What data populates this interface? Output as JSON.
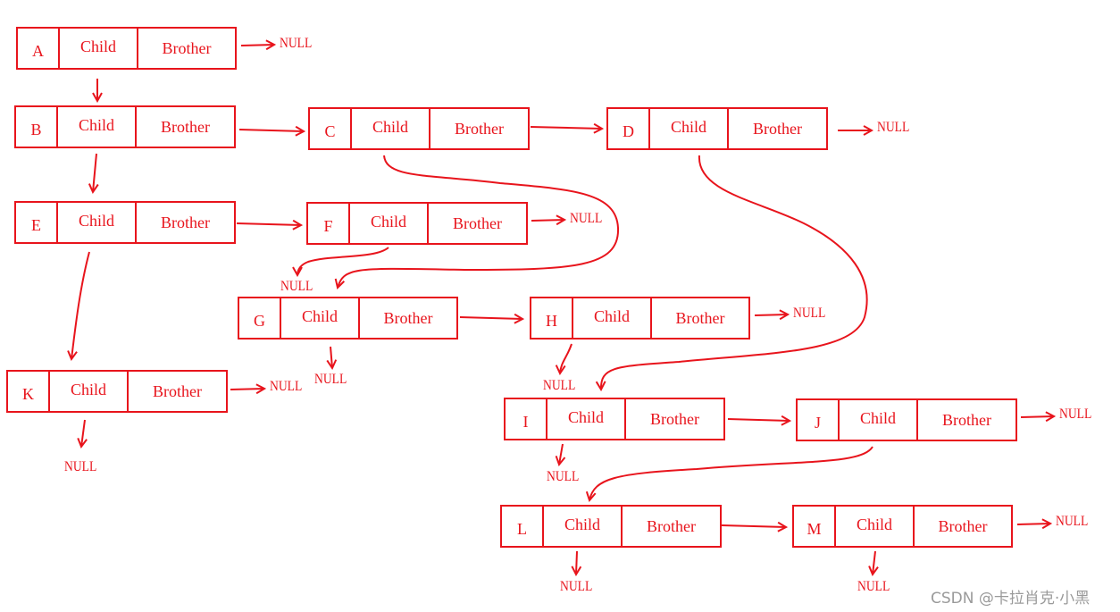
{
  "nodes": [
    {
      "name": "A",
      "child": "Child",
      "brother": "Brother"
    },
    {
      "name": "B",
      "child": "Child",
      "brother": "Brother"
    },
    {
      "name": "C",
      "child": "Child",
      "brother": "Brother"
    },
    {
      "name": "D",
      "child": "Child",
      "brother": "Brother"
    },
    {
      "name": "E",
      "child": "Child",
      "brother": "Brother"
    },
    {
      "name": "F",
      "child": "Child",
      "brother": "Brother"
    },
    {
      "name": "G",
      "child": "Child",
      "brother": "Brother"
    },
    {
      "name": "H",
      "child": "Child",
      "brother": "Brother"
    },
    {
      "name": "K",
      "child": "Child",
      "brother": "Brother"
    },
    {
      "name": "I",
      "child": "Child",
      "brother": "Brother"
    },
    {
      "name": "J",
      "child": "Child",
      "brother": "Brother"
    },
    {
      "name": "L",
      "child": "Child",
      "brother": "Brother"
    },
    {
      "name": "M",
      "child": "Child",
      "brother": "Brother"
    }
  ],
  "null_label": "NULL",
  "color": "#e8141c",
  "watermark": "CSDN @卡拉肖克·小黑"
}
